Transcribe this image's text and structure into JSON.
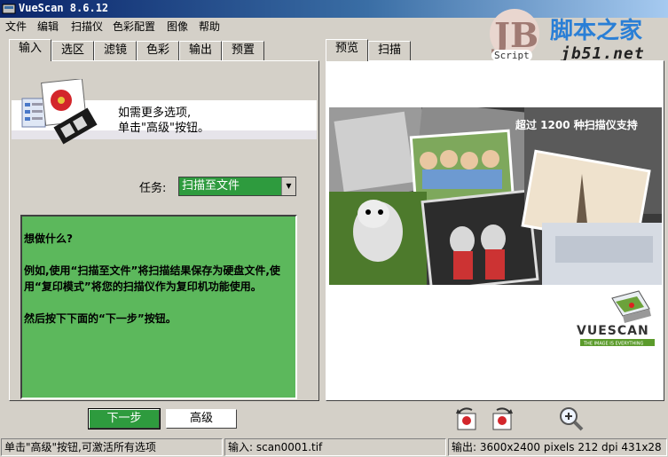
{
  "window": {
    "title": "VueScan 8.6.12"
  },
  "menu": [
    "文件",
    "编辑",
    "扫描仪",
    "色彩配置",
    "图像",
    "帮助"
  ],
  "watermark": {
    "badge": "JB",
    "script": "Script",
    "cn": "脚本之家",
    "url": "jb51.net"
  },
  "left_tabs": [
    "输入",
    "选区",
    "滤镜",
    "色彩",
    "输出",
    "预置"
  ],
  "right_tabs": [
    "预览",
    "扫描"
  ],
  "banner": {
    "line1": "如需更多选项,",
    "line2": "单击\"高级\"按钮。"
  },
  "task": {
    "label": "任务:",
    "value": "扫描至文件"
  },
  "help": {
    "p1": "想做什么?",
    "p2": "例如,使用“扫描至文件”将扫描结果保存为硬盘文件,使用“复印模式”将您的扫描仪作为复印机功能使用。",
    "p3": "然后按下下面的“下一步”按钮。"
  },
  "preview": {
    "caption": "超过 1200 种扫描仪支持",
    "brand": "VUESCAN",
    "tagline": "THE IMAGE IS EVERYTHING"
  },
  "buttons": {
    "next": "下一步",
    "advanced": "高级"
  },
  "icons": [
    "rotate-left-icon",
    "rotate-right-icon",
    "zoom-in-icon"
  ],
  "status": {
    "hint": "单击\"高级\"按钮,可激活所有选项",
    "input": "输入: scan0001.tif",
    "output": "输出: 3600x2400 pixels 212 dpi 431x28"
  },
  "colors": {
    "accent_green": "#2e9b3e",
    "help_bg": "#5cb85c",
    "title_blue": "#0a246a"
  }
}
